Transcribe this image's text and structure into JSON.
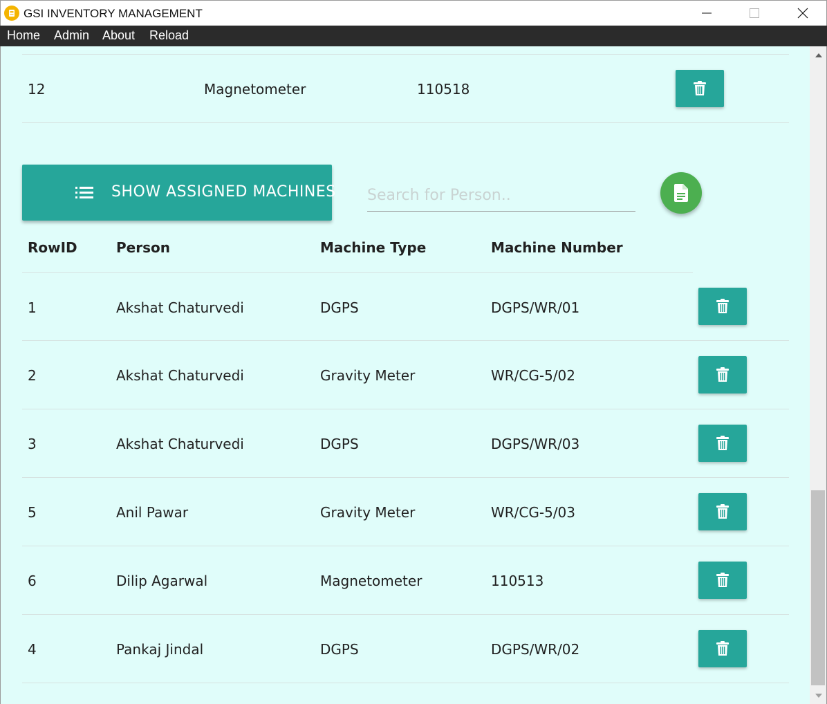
{
  "window": {
    "title": "GSI INVENTORY MANAGEMENT"
  },
  "menu": {
    "items": [
      {
        "label": "Home"
      },
      {
        "label": "Admin"
      },
      {
        "label": "About"
      },
      {
        "label": "Reload"
      }
    ]
  },
  "top_table": {
    "last_row": {
      "id": "12",
      "type": "Magnetometer",
      "number": "110518"
    }
  },
  "toolbar": {
    "show_button_label": "SHOW ASSIGNED MACHINES",
    "search_placeholder": "Search for Person.."
  },
  "assigned_table": {
    "headers": [
      "RowID",
      "Person",
      "Machine Type",
      "Machine Number"
    ],
    "rows": [
      {
        "id": "1",
        "person": "Akshat Chaturvedi",
        "type": "DGPS",
        "number": "DGPS/WR/01"
      },
      {
        "id": "2",
        "person": "Akshat Chaturvedi",
        "type": "Gravity Meter",
        "number": "WR/CG-5/02"
      },
      {
        "id": "3",
        "person": "Akshat Chaturvedi",
        "type": "DGPS",
        "number": "DGPS/WR/03"
      },
      {
        "id": "5",
        "person": "Anil Pawar",
        "type": "Gravity Meter",
        "number": "WR/CG-5/03"
      },
      {
        "id": "6",
        "person": "Dilip Agarwal",
        "type": "Magnetometer",
        "number": "110513"
      },
      {
        "id": "4",
        "person": "Pankaj Jindal",
        "type": "DGPS",
        "number": "DGPS/WR/02"
      }
    ]
  },
  "colors": {
    "accent": "#26a69a",
    "fab": "#4caf50",
    "background": "#e0fdfa",
    "menubar": "#2b2b2b"
  },
  "icons": {
    "delete": "trash-icon",
    "show": "list-icon",
    "report": "document-icon"
  }
}
